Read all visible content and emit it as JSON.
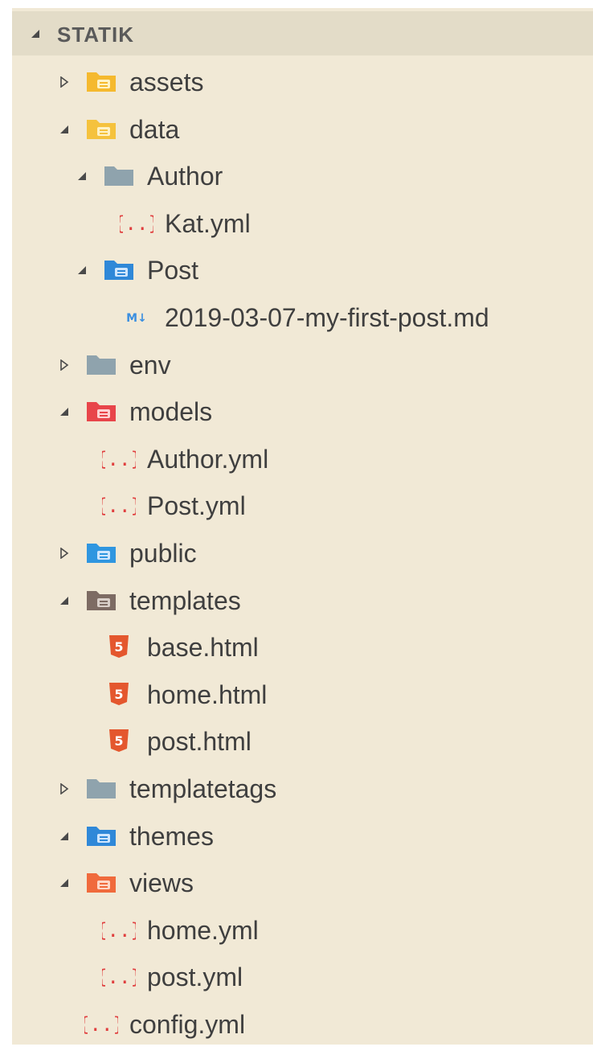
{
  "explorer": {
    "title": "STATIK"
  },
  "tree": [
    {
      "label": "assets",
      "depth": 0,
      "kind": "folder",
      "expanded": false,
      "icon": "folder-assets-icon",
      "color": "#f5b92e"
    },
    {
      "label": "data",
      "depth": 0,
      "kind": "folder",
      "expanded": true,
      "icon": "folder-data-icon",
      "color": "#f5c23d"
    },
    {
      "label": "Author",
      "depth": 1,
      "kind": "folder",
      "expanded": true,
      "icon": "folder-icon",
      "color": "#8fa3ad"
    },
    {
      "label": "Kat.yml",
      "depth": 2,
      "kind": "yaml",
      "icon": "yaml-file-icon",
      "color": "#e03e3e"
    },
    {
      "label": "Post",
      "depth": 1,
      "kind": "folder",
      "expanded": true,
      "icon": "folder-post-icon",
      "color": "#2f88d8"
    },
    {
      "label": "2019-03-07-my-first-post.md",
      "depth": 2,
      "kind": "markdown",
      "icon": "markdown-file-icon",
      "color": "#3b8fe0"
    },
    {
      "label": "env",
      "depth": 0,
      "kind": "folder",
      "expanded": false,
      "icon": "folder-icon",
      "color": "#8fa3ad"
    },
    {
      "label": "models",
      "depth": 0,
      "kind": "folder",
      "expanded": true,
      "icon": "folder-models-icon",
      "color": "#e8454a"
    },
    {
      "label": "Author.yml",
      "depth": 1,
      "kind": "yaml",
      "icon": "yaml-file-icon",
      "color": "#e03e3e"
    },
    {
      "label": "Post.yml",
      "depth": 1,
      "kind": "yaml",
      "icon": "yaml-file-icon",
      "color": "#e03e3e"
    },
    {
      "label": "public",
      "depth": 0,
      "kind": "folder",
      "expanded": false,
      "icon": "folder-public-icon",
      "color": "#2f96e0"
    },
    {
      "label": "templates",
      "depth": 0,
      "kind": "folder",
      "expanded": true,
      "icon": "folder-templates-icon",
      "color": "#7d6b63"
    },
    {
      "label": "base.html",
      "depth": 1,
      "kind": "html",
      "icon": "html5-file-icon",
      "color": "#e4572e"
    },
    {
      "label": "home.html",
      "depth": 1,
      "kind": "html",
      "icon": "html5-file-icon",
      "color": "#e4572e"
    },
    {
      "label": "post.html",
      "depth": 1,
      "kind": "html",
      "icon": "html5-file-icon",
      "color": "#e4572e"
    },
    {
      "label": "templatetags",
      "depth": 0,
      "kind": "folder",
      "expanded": false,
      "icon": "folder-icon",
      "color": "#8fa3ad"
    },
    {
      "label": "themes",
      "depth": 0,
      "kind": "folder",
      "expanded": true,
      "icon": "folder-themes-icon",
      "color": "#2f88d8"
    },
    {
      "label": "views",
      "depth": 0,
      "kind": "folder",
      "expanded": true,
      "icon": "folder-views-icon",
      "color": "#f06a3c"
    },
    {
      "label": "home.yml",
      "depth": 1,
      "kind": "yaml",
      "icon": "yaml-file-icon",
      "color": "#e03e3e"
    },
    {
      "label": "post.yml",
      "depth": 1,
      "kind": "yaml",
      "icon": "yaml-file-icon",
      "color": "#e03e3e"
    },
    {
      "label": "config.yml",
      "depth": 0,
      "kind": "yaml",
      "icon": "yaml-file-icon",
      "color": "#e03e3e"
    }
  ]
}
